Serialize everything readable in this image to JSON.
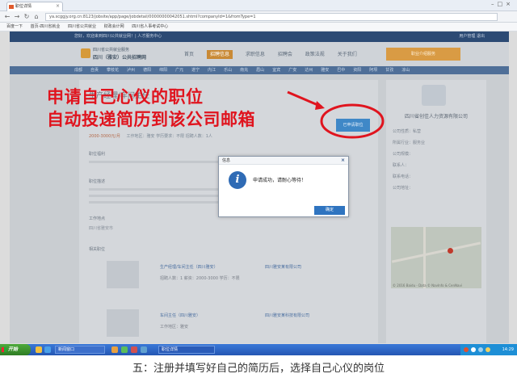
{
  "browser": {
    "tab_title": "职位详情",
    "url": "ya.scggjy.org.cn:8123/jobsite/app/page/jobdetail/00000000042051.shtml?companyId=1&fromType=1",
    "bookmarks": [
      "百度一下",
      "首页-四川省就业",
      "四川省公共就业",
      "财政会计网",
      "四川省人事考试中心"
    ]
  },
  "site": {
    "top_strip_text": "您好，欢迎来到四川公共就业网！| 人才服务中心",
    "top_strip_right": "用户管理  退出",
    "logo_line1": "四川省公共就业服务",
    "logo_line2": "四川（雅安）公共招聘网",
    "nav": [
      "首页",
      "招聘信息",
      "求职信息",
      "招聘会",
      "政策法规",
      "关于我们"
    ],
    "orange_button": "职业介绍服务",
    "categories": [
      "成都",
      "自贡",
      "攀枝花",
      "泸州",
      "德阳",
      "绵阳",
      "广元",
      "遂宁",
      "内江",
      "乐山",
      "南充",
      "眉山",
      "宜宾",
      "广安",
      "达州",
      "雅安",
      "巴中",
      "资阳",
      "阿坝",
      "甘孜",
      "凉山"
    ]
  },
  "job": {
    "title": "生产经理/车间主任",
    "salary": "2000-3000元/月",
    "meta": "工作地区：雅安  学历要求：不限  招聘人数：1人",
    "apply_button": "已申请职位",
    "sections": {
      "benefits": "职位福利",
      "description": "职位描述",
      "location": "工作地点",
      "location_value": "四川省雅安市",
      "related": "相关职位"
    },
    "related_jobs": [
      {
        "title": "生产经理/车间主任（四川雅安）",
        "company": "四川雅安某有限公司",
        "detail": "招聘人数：1  薪资：2000-3000  学历：不限"
      },
      {
        "title": "车间主任（四川雅安）",
        "company": "四川雅安某科技有限公司",
        "detail": "工作地区：雅安"
      }
    ]
  },
  "company": {
    "name": "四川省创佳人力资源有限公司",
    "info": [
      "公司性质：私营",
      "所属行业：服务业",
      "公司规模：",
      "联系人：",
      "联系电话：",
      "公司地址："
    ],
    "map_caption": "© 2016 Baidu - Data © NavInfo & CenNavi"
  },
  "annotation": {
    "line1": "申请自己心仪的职位",
    "line2": "自动投递简历到该公司邮箱",
    "color": "#e0141e"
  },
  "dialog": {
    "title": "信息",
    "message": "申请成功，请耐心等待！",
    "ok_button": "确定",
    "close": "×"
  },
  "taskbar": {
    "start": "开始",
    "tasks": [
      "新闻窗口",
      "职位详情"
    ],
    "clock": "14:29"
  },
  "caption": "五：注册并填写好自己的简历后，选择自己心仪的岗位"
}
